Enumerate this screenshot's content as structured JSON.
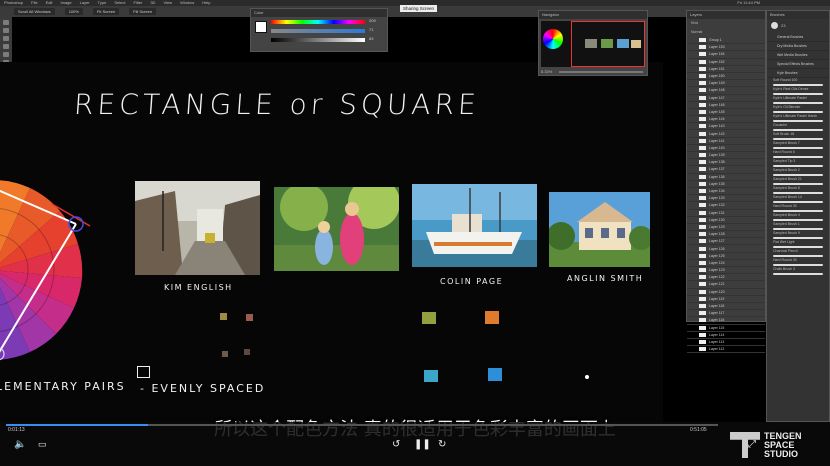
{
  "app": {
    "menu": [
      "Photoshop",
      "File",
      "Edit",
      "Image",
      "Layer",
      "Type",
      "Select",
      "Filter",
      "3D",
      "View",
      "Window",
      "Help"
    ],
    "clock": "Fri 11:44 PM",
    "options": [
      "Scroll All Windows",
      "100%",
      "Fit Screen",
      "Fill Screen"
    ]
  },
  "panels": {
    "color": {
      "title": "Color",
      "values": [
        "209",
        "71",
        "83"
      ]
    },
    "navigator": {
      "title": "Navigator",
      "zoom": "8.33%"
    },
    "sharing": {
      "label": "Sharing Screen"
    },
    "layers": {
      "title": "Layers",
      "filter": "Kind",
      "mode": "Normal",
      "rows": [
        "Group 1",
        "Layer 153",
        "Layer 154",
        "Layer 152",
        "Layer 151",
        "Layer 150",
        "Layer 149",
        "Layer 148",
        "Layer 147",
        "Layer 146",
        "Layer 145",
        "Layer 144",
        "Layer 143",
        "Layer 142",
        "Layer 141",
        "Layer 140",
        "Layer 139",
        "Layer 138",
        "Layer 137",
        "Layer 136",
        "Layer 135",
        "Layer 134",
        "Layer 133",
        "Layer 132",
        "Layer 131",
        "Layer 130",
        "Layer 129",
        "Layer 128",
        "Layer 127",
        "Layer 126",
        "Layer 125",
        "Layer 124",
        "Layer 123",
        "Layer 122",
        "Layer 121",
        "Layer 120",
        "Layer 119",
        "Layer 118",
        "Layer 117",
        "Layer 116",
        "Layer 115",
        "Layer 114",
        "Layer 113",
        "Layer 112"
      ]
    },
    "brushes": {
      "title": "Brushes",
      "size": "23",
      "folders": [
        "General Brushes",
        "Dry Media Brushes",
        "Wet Media Brushes",
        "Special Effects Brushes",
        "Kyle Brushes"
      ],
      "rows": [
        "Soft Round 100",
        "Kyle's Real Oils Dense",
        "Kyle's Ultimate Pastel",
        "Kyle's Oil Blender",
        "Kyle's Ultimate Pastel Harsh",
        "Gouache",
        "Soft Brush 18",
        "Sampled Brush 7",
        "Hard Round 6",
        "Sampled Tip 3",
        "Sampled Brush 2",
        "Sampled Brush 21",
        "Sampled Brush 8",
        "Sampled Brush 14",
        "Hard Round 30",
        "Sampled Brush 4",
        "Sampled Brush 1",
        "Sampled Brush 9",
        "Flat Wet Light",
        "Charcoal Pencil",
        "Hard Round 30",
        "Chalk Brush 3"
      ]
    }
  },
  "canvas": {
    "title": "RECTANGLE   or SQUARE",
    "captions": [
      {
        "text": "KIM ENGLISH"
      },
      {
        "text": "COLIN PAGE"
      },
      {
        "text": "ANGLIN SMITH"
      }
    ],
    "left_text": "LEMENTARY PAIRS",
    "note_text": "- EVENLY SPACED",
    "swatch_colors": [
      "#a08a44",
      "#9a5a4c",
      "#6e5a4a",
      "#5a4a40",
      "#94a040",
      "#e07a2c",
      "#3aa6c8",
      "#2f8ed8",
      "#ffffff"
    ]
  },
  "subtitle": "所以这个配色方法 真的很适用于色彩丰富的画面上",
  "player": {
    "elapsed": "0:01:13",
    "duration": "0:51:05",
    "progress": 0.2
  },
  "watermark": {
    "text": [
      "TENGEN",
      "SPACE",
      "STUDIO"
    ]
  },
  "colors": {
    "accent": "#3a8df0",
    "canvas": "#060606"
  }
}
